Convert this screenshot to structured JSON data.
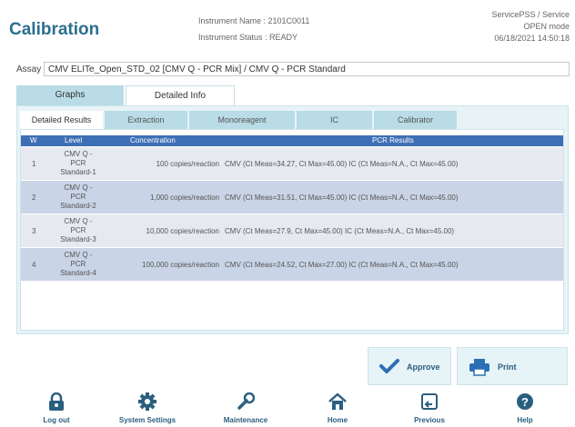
{
  "header": {
    "title": "Calibration",
    "instrument_name": "Instrument Name : 2101C0011",
    "instrument_status": "Instrument Status : READY",
    "user": "ServicePSS / Service",
    "mode": "OPEN mode",
    "datetime": "06/18/2021 14:50:18"
  },
  "assay": {
    "label": "Assay",
    "value": "CMV ELITe_Open_STD_02 [CMV Q - PCR Mix] / CMV Q - PCR Standard"
  },
  "outer_tabs": [
    "Graphs",
    "Detailed Info"
  ],
  "inner_tabs": [
    "Detailed Results",
    "Extraction",
    "Monoreagent",
    "IC",
    "Calibrator"
  ],
  "table": {
    "headers": [
      "W",
      "Level",
      "Concentration",
      "PCR Results"
    ],
    "rows": [
      {
        "w": "1",
        "level": "CMV Q - PCR Standard-1",
        "concentration": "100 copies/reaction",
        "pcr": "CMV (Ct Meas=34.27, Ct Max=45.00) IC (Ct Meas=N.A., Ct Max=45.00)"
      },
      {
        "w": "2",
        "level": "CMV Q - PCR Standard-2",
        "concentration": "1,000 copies/reaction",
        "pcr": "CMV (Ct Meas=31.51, Ct Max=45.00) IC (Ct Meas=N.A., Ct Max=45.00)"
      },
      {
        "w": "3",
        "level": "CMV Q - PCR Standard-3",
        "concentration": "10,000 copies/reaction",
        "pcr": "CMV (Ct Meas=27.9, Ct Max=45.00) IC (Ct Meas=N.A., Ct Max=45.00)"
      },
      {
        "w": "4",
        "level": "CMV Q - PCR Standard-4",
        "concentration": "100,000 copies/reaction",
        "pcr": "CMV (Ct Meas=24.52, Ct Max=27.00) IC (Ct Meas=N.A., Ct Max=45.00)"
      }
    ]
  },
  "actions": {
    "approve": "Approve",
    "print": "Print"
  },
  "nav": {
    "logout": "Log out",
    "settings": "System Settings",
    "maintenance": "Maintenance",
    "home": "Home",
    "previous": "Previous",
    "help": "Help"
  },
  "colors": {
    "title": "#2b6f8f",
    "tab_active": "#ffffff",
    "tab_inactive": "#b9dce6",
    "table_header": "#3d6fb5",
    "row_odd": "#e6e9ef",
    "row_even": "#c9d4e6",
    "nav_icon": "#2b5f7f",
    "approve_check": "#2b6fb5"
  },
  "icons": {
    "approve": "check-icon",
    "print": "printer-icon",
    "logout": "lock-icon",
    "settings": "gear-icon",
    "maintenance": "wrench-icon",
    "home": "home-icon",
    "previous": "previous-screen-icon",
    "help": "question-icon"
  }
}
